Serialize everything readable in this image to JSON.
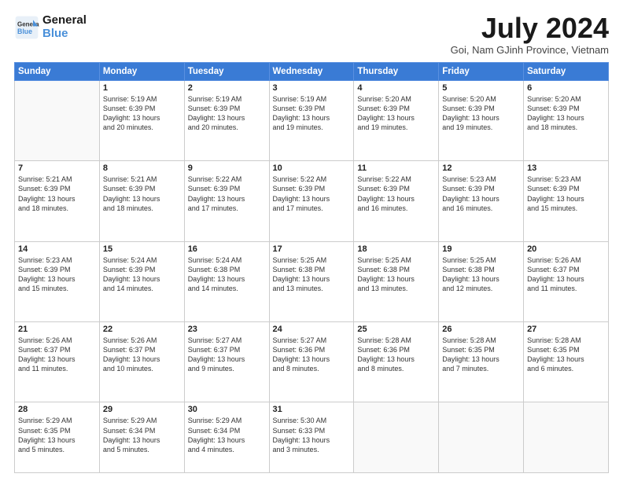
{
  "header": {
    "logo_line1": "General",
    "logo_line2": "Blue",
    "title": "July 2024",
    "location": "Goi, Nam GJinh Province, Vietnam"
  },
  "weekdays": [
    "Sunday",
    "Monday",
    "Tuesday",
    "Wednesday",
    "Thursday",
    "Friday",
    "Saturday"
  ],
  "weeks": [
    [
      {
        "day": "",
        "info": ""
      },
      {
        "day": "1",
        "info": "Sunrise: 5:19 AM\nSunset: 6:39 PM\nDaylight: 13 hours\nand 20 minutes."
      },
      {
        "day": "2",
        "info": "Sunrise: 5:19 AM\nSunset: 6:39 PM\nDaylight: 13 hours\nand 20 minutes."
      },
      {
        "day": "3",
        "info": "Sunrise: 5:19 AM\nSunset: 6:39 PM\nDaylight: 13 hours\nand 19 minutes."
      },
      {
        "day": "4",
        "info": "Sunrise: 5:20 AM\nSunset: 6:39 PM\nDaylight: 13 hours\nand 19 minutes."
      },
      {
        "day": "5",
        "info": "Sunrise: 5:20 AM\nSunset: 6:39 PM\nDaylight: 13 hours\nand 19 minutes."
      },
      {
        "day": "6",
        "info": "Sunrise: 5:20 AM\nSunset: 6:39 PM\nDaylight: 13 hours\nand 18 minutes."
      }
    ],
    [
      {
        "day": "7",
        "info": "Sunrise: 5:21 AM\nSunset: 6:39 PM\nDaylight: 13 hours\nand 18 minutes."
      },
      {
        "day": "8",
        "info": "Sunrise: 5:21 AM\nSunset: 6:39 PM\nDaylight: 13 hours\nand 18 minutes."
      },
      {
        "day": "9",
        "info": "Sunrise: 5:22 AM\nSunset: 6:39 PM\nDaylight: 13 hours\nand 17 minutes."
      },
      {
        "day": "10",
        "info": "Sunrise: 5:22 AM\nSunset: 6:39 PM\nDaylight: 13 hours\nand 17 minutes."
      },
      {
        "day": "11",
        "info": "Sunrise: 5:22 AM\nSunset: 6:39 PM\nDaylight: 13 hours\nand 16 minutes."
      },
      {
        "day": "12",
        "info": "Sunrise: 5:23 AM\nSunset: 6:39 PM\nDaylight: 13 hours\nand 16 minutes."
      },
      {
        "day": "13",
        "info": "Sunrise: 5:23 AM\nSunset: 6:39 PM\nDaylight: 13 hours\nand 15 minutes."
      }
    ],
    [
      {
        "day": "14",
        "info": "Sunrise: 5:23 AM\nSunset: 6:39 PM\nDaylight: 13 hours\nand 15 minutes."
      },
      {
        "day": "15",
        "info": "Sunrise: 5:24 AM\nSunset: 6:39 PM\nDaylight: 13 hours\nand 14 minutes."
      },
      {
        "day": "16",
        "info": "Sunrise: 5:24 AM\nSunset: 6:38 PM\nDaylight: 13 hours\nand 14 minutes."
      },
      {
        "day": "17",
        "info": "Sunrise: 5:25 AM\nSunset: 6:38 PM\nDaylight: 13 hours\nand 13 minutes."
      },
      {
        "day": "18",
        "info": "Sunrise: 5:25 AM\nSunset: 6:38 PM\nDaylight: 13 hours\nand 13 minutes."
      },
      {
        "day": "19",
        "info": "Sunrise: 5:25 AM\nSunset: 6:38 PM\nDaylight: 13 hours\nand 12 minutes."
      },
      {
        "day": "20",
        "info": "Sunrise: 5:26 AM\nSunset: 6:37 PM\nDaylight: 13 hours\nand 11 minutes."
      }
    ],
    [
      {
        "day": "21",
        "info": "Sunrise: 5:26 AM\nSunset: 6:37 PM\nDaylight: 13 hours\nand 11 minutes."
      },
      {
        "day": "22",
        "info": "Sunrise: 5:26 AM\nSunset: 6:37 PM\nDaylight: 13 hours\nand 10 minutes."
      },
      {
        "day": "23",
        "info": "Sunrise: 5:27 AM\nSunset: 6:37 PM\nDaylight: 13 hours\nand 9 minutes."
      },
      {
        "day": "24",
        "info": "Sunrise: 5:27 AM\nSunset: 6:36 PM\nDaylight: 13 hours\nand 8 minutes."
      },
      {
        "day": "25",
        "info": "Sunrise: 5:28 AM\nSunset: 6:36 PM\nDaylight: 13 hours\nand 8 minutes."
      },
      {
        "day": "26",
        "info": "Sunrise: 5:28 AM\nSunset: 6:35 PM\nDaylight: 13 hours\nand 7 minutes."
      },
      {
        "day": "27",
        "info": "Sunrise: 5:28 AM\nSunset: 6:35 PM\nDaylight: 13 hours\nand 6 minutes."
      }
    ],
    [
      {
        "day": "28",
        "info": "Sunrise: 5:29 AM\nSunset: 6:35 PM\nDaylight: 13 hours\nand 5 minutes."
      },
      {
        "day": "29",
        "info": "Sunrise: 5:29 AM\nSunset: 6:34 PM\nDaylight: 13 hours\nand 5 minutes."
      },
      {
        "day": "30",
        "info": "Sunrise: 5:29 AM\nSunset: 6:34 PM\nDaylight: 13 hours\nand 4 minutes."
      },
      {
        "day": "31",
        "info": "Sunrise: 5:30 AM\nSunset: 6:33 PM\nDaylight: 13 hours\nand 3 minutes."
      },
      {
        "day": "",
        "info": ""
      },
      {
        "day": "",
        "info": ""
      },
      {
        "day": "",
        "info": ""
      }
    ]
  ]
}
